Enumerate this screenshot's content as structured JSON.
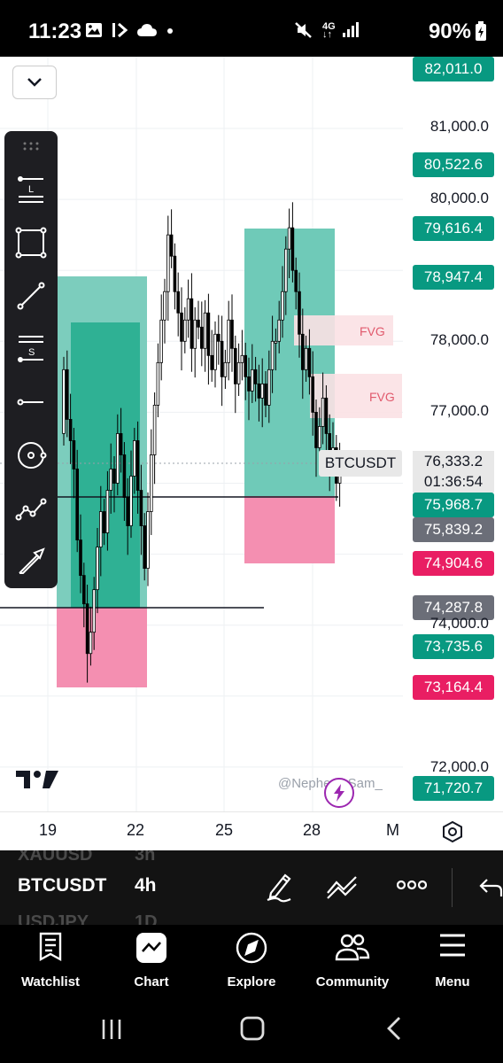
{
  "status_bar": {
    "time": "11:23",
    "network": "4G",
    "battery": "90%"
  },
  "chart": {
    "price_labels": [
      {
        "text": "82,011.0",
        "kind": "green"
      },
      {
        "text": "81,000.0",
        "kind": "plain"
      },
      {
        "text": "80,522.6",
        "kind": "green"
      },
      {
        "text": "80,000.0",
        "kind": "plain"
      },
      {
        "text": "79,616.4",
        "kind": "green"
      },
      {
        "text": "78,947.4",
        "kind": "green"
      },
      {
        "text": "78,000.0",
        "kind": "plain"
      },
      {
        "text": "77,000.0",
        "kind": "plain"
      },
      {
        "text": "76,333.2",
        "kind": "current"
      },
      {
        "text": "01:36:54",
        "kind": "countdown"
      },
      {
        "text": "75,968.7",
        "kind": "green"
      },
      {
        "text": "75,839.2",
        "kind": "gray"
      },
      {
        "text": "74,904.6",
        "kind": "red"
      },
      {
        "text": "74,287.8",
        "kind": "gray"
      },
      {
        "text": "74,000.0",
        "kind": "plain"
      },
      {
        "text": "73,735.6",
        "kind": "green"
      },
      {
        "text": "73,164.4",
        "kind": "red"
      },
      {
        "text": "72,000.0",
        "kind": "plain"
      },
      {
        "text": "71,720.7",
        "kind": "green"
      }
    ],
    "symbol_tag": "BTCUSDT",
    "fvg_labels": [
      "FVG",
      "FVG"
    ],
    "watermark": "@Nephew_Sam_",
    "logo": "TV"
  },
  "time_axis": {
    "labels": [
      "19",
      "22",
      "25",
      "28",
      "M"
    ]
  },
  "symbol_bar": {
    "ghost_above": {
      "symbol": "XAUUSD",
      "interval": "3h"
    },
    "symbol": "BTCUSDT",
    "interval": "4h",
    "ghost_below": {
      "symbol": "USDJPY",
      "interval": "1D"
    }
  },
  "bottom_nav": {
    "items": [
      {
        "label": "Watchlist",
        "icon": "watchlist-icon"
      },
      {
        "label": "Chart",
        "icon": "chart-icon"
      },
      {
        "label": "Explore",
        "icon": "compass-icon"
      },
      {
        "label": "Community",
        "icon": "community-icon"
      },
      {
        "label": "Menu",
        "icon": "menu-icon"
      }
    ]
  },
  "colors": {
    "green": "#089981",
    "red": "#e91e63",
    "gray": "#6b6e78",
    "teal_zone": "#2aa88f",
    "pink_zone": "#f06a9c"
  }
}
